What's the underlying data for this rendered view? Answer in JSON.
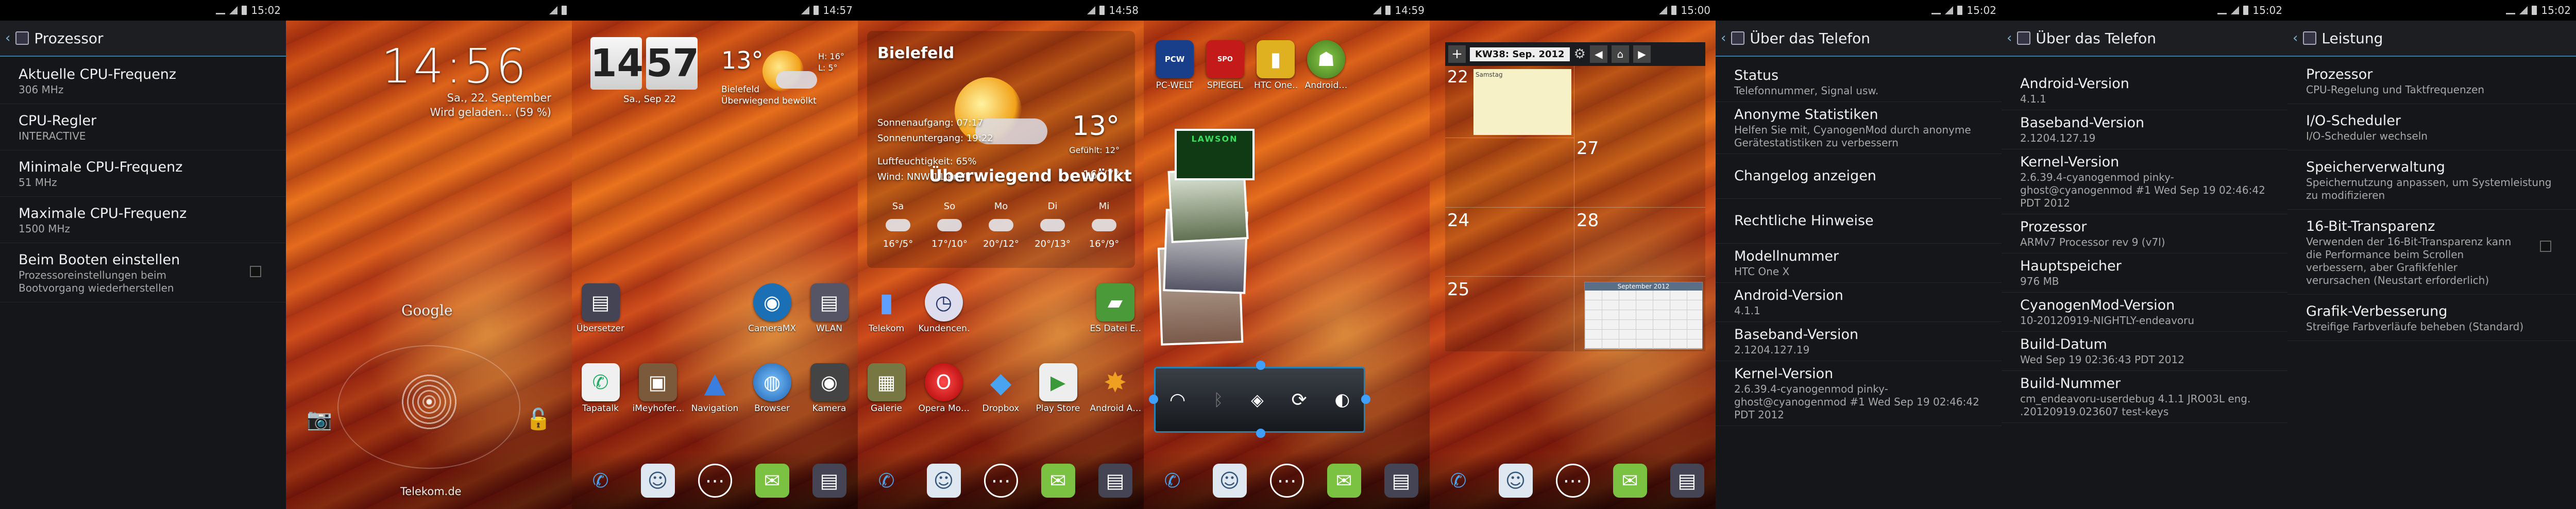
{
  "status_times": [
    "15:02",
    "",
    "14:57",
    "14:58",
    "14:59",
    "15:00",
    "15:02",
    "15:02",
    "15:02"
  ],
  "colors": {
    "accent": "#2b7fae",
    "settings_bg": "#151619",
    "summary_text": "#a8a8a8"
  },
  "panel1": {
    "title": "Prozessor",
    "items": [
      {
        "title": "Aktuelle CPU-Frequenz",
        "summary": "306 MHz"
      },
      {
        "title": "CPU-Regler",
        "summary": "INTERACTIVE"
      },
      {
        "title": "Minimale CPU-Frequenz",
        "summary": "51 MHz"
      },
      {
        "title": "Maximale CPU-Frequenz",
        "summary": "1500 MHz"
      },
      {
        "title": "Beim Booten einstellen",
        "summary": "Prozessoreinstellungen beim Bootvorgang wiederherstellen"
      }
    ]
  },
  "panel2": {
    "clock": "14:56",
    "date": "Sa., 22. September",
    "charging": "Wird geladen... (59 %)",
    "google": "Google",
    "carrier": "Telekom.de"
  },
  "panel3": {
    "hour": "14",
    "minute": "57",
    "date": "Sa., Sep 22",
    "temp": "13°",
    "city": "Bielefeld",
    "cond": "Überwiegend bewölkt",
    "hi": "H: 16°",
    "lo": "L: 5°",
    "icons_row1": [
      {
        "label": "Übersetzer",
        "icon": "widget-icon",
        "color": "#445"
      },
      {
        "label": "",
        "icon": "",
        "color": ""
      },
      {
        "label": "",
        "icon": "",
        "color": ""
      },
      {
        "label": "CameraMX",
        "icon": "camera-icon",
        "color": "#1a6fb5"
      },
      {
        "label": "WLAN",
        "icon": "wifi-icon",
        "color": "#556"
      }
    ],
    "icons_row2": [
      {
        "label": "Tapatalk",
        "icon": "tapatalk-icon",
        "color": "#f0f0f0"
      },
      {
        "label": "iMeyhofer…",
        "icon": "mobile-icon",
        "color": "#7a5a3a"
      },
      {
        "label": "Navigation",
        "icon": "navigation-icon",
        "color": "#2255aa"
      },
      {
        "label": "Browser",
        "icon": "globe-icon",
        "color": "#2a7fd0"
      },
      {
        "label": "Kamera",
        "icon": "camera-icon",
        "color": "#444"
      }
    ]
  },
  "panel4": {
    "city": "Bielefeld",
    "temp": "13°",
    "cond": "Überwiegend bewölkt",
    "sunrise": "Sonnenaufgang: 07:17",
    "sunset": "Sonnenuntergang: 19:22",
    "humidity": "Luftfeuchtigkeit: 65%",
    "wind": "Wind: NNW 11 km/h",
    "feels": "Gefühlt: 12°",
    "hilo": "16°/7°",
    "forecast": [
      {
        "day": "Sa",
        "temp": "16°/5°"
      },
      {
        "day": "So",
        "temp": "17°/10°"
      },
      {
        "day": "Mo",
        "temp": "20°/12°"
      },
      {
        "day": "Di",
        "temp": "20°/13°"
      },
      {
        "day": "Mi",
        "temp": "16°/9°"
      }
    ],
    "icons_row1": [
      {
        "label": "Telekom",
        "icon": "chart-icon",
        "color": "#3f7fd0"
      },
      {
        "label": "Kundencen…",
        "icon": "clock-icon",
        "color": "#dde"
      },
      {
        "label": "",
        "icon": "",
        "color": ""
      },
      {
        "label": "",
        "icon": "",
        "color": ""
      },
      {
        "label": "ES Datei E…",
        "icon": "folder-icon",
        "color": "#4a9a3a"
      }
    ],
    "icons_row2": [
      {
        "label": "Galerie",
        "icon": "gallery-icon",
        "color": "#774"
      },
      {
        "label": "Opera Mo…",
        "icon": "opera-icon",
        "color": "#c21010"
      },
      {
        "label": "Dropbox",
        "icon": "dropbox-icon",
        "color": "#2a7fd0"
      },
      {
        "label": "Play Store",
        "icon": "play-store-icon",
        "color": "#eee"
      },
      {
        "label": "Android A…",
        "icon": "android-icon",
        "color": "#8cc84b"
      }
    ]
  },
  "panel5": {
    "top_labels": [
      "PC-WELT",
      "SPIEGEL",
      "HTC One…",
      "Android…"
    ],
    "stack_title": "LAWSON"
  },
  "panel6": {
    "week": "KW38: Sep. 2012",
    "days": [
      "22",
      "24",
      "25",
      "27",
      "28"
    ],
    "note": "Samstag",
    "mini_title": "September 2012"
  },
  "panel7": {
    "title": "Über das Telefon",
    "items": [
      {
        "title": "Status",
        "summary": "Telefonnummer, Signal usw."
      },
      {
        "title": "Anonyme Statistiken",
        "summary": "Helfen Sie mit, CyanogenMod durch anonyme Gerätestatistiken zu verbessern"
      },
      {
        "title": "Changelog anzeigen",
        "summary": ""
      },
      {
        "title": "Rechtliche Hinweise",
        "summary": ""
      },
      {
        "title": "Modellnummer",
        "summary": "HTC One X"
      },
      {
        "title": "Android-Version",
        "summary": "4.1.1"
      },
      {
        "title": "Baseband-Version",
        "summary": "2.1204.127.19"
      },
      {
        "title": "Kernel-Version",
        "summary": "2.6.39.4-cyanogenmod pinky-ghost@cyanogenmod #1 Wed Sep 19 02:46:42 PDT 2012"
      }
    ]
  },
  "panel8": {
    "title": "Über das Telefon",
    "items": [
      {
        "title": "Android-Version",
        "summary": "4.1.1"
      },
      {
        "title": "Baseband-Version",
        "summary": "2.1204.127.19"
      },
      {
        "title": "Kernel-Version",
        "summary": "2.6.39.4-cyanogenmod pinky-ghost@cyanogenmod #1 Wed Sep 19 02:46:42 PDT 2012"
      },
      {
        "title": "Prozessor",
        "summary": "ARMv7 Processor rev 9 (v7l)"
      },
      {
        "title": "Hauptspeicher",
        "summary": "976 MB"
      },
      {
        "title": "CyanogenMod-Version",
        "summary": "10-20120919-NIGHTLY-endeavoru"
      },
      {
        "title": "Build-Datum",
        "summary": "Wed Sep 19 02:36:43 PDT 2012"
      },
      {
        "title": "Build-Nummer",
        "summary": "cm_endeavoru-userdebug 4.1.1 JRO03L eng. .20120919.023607 test-keys"
      }
    ]
  },
  "panel9": {
    "title": "Leistung",
    "items": [
      {
        "title": "Prozessor",
        "summary": "CPU-Regelung und Taktfrequenzen"
      },
      {
        "title": "I/O-Scheduler",
        "summary": "I/O-Scheduler wechseln"
      },
      {
        "title": "Speicherverwaltung",
        "summary": "Speichernutzung anpassen, um Systemleistung zu modifizieren"
      },
      {
        "title": "16-Bit-Transparenz",
        "summary": "Verwenden der 16-Bit-Transparenz kann die Performance beim Scrollen verbessern, aber Grafikfehler verursachen (Neustart erforderlich)"
      },
      {
        "title": "Grafik-Verbesserung",
        "summary": "Streifige Farbverläufe beheben (Standard)"
      }
    ]
  }
}
